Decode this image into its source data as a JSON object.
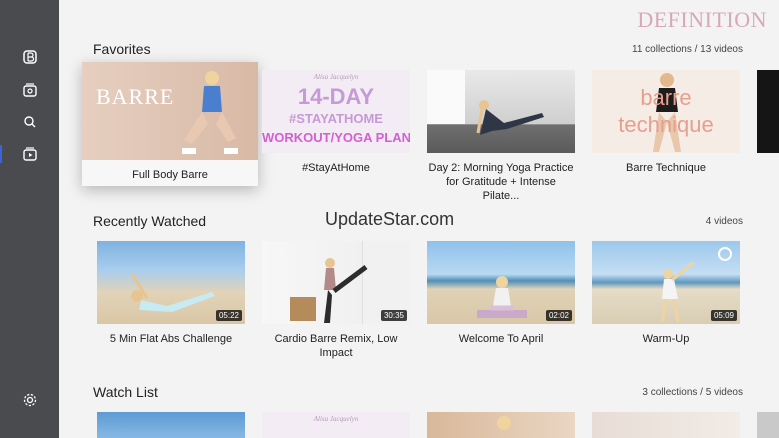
{
  "brand": {
    "name": "DEFINITION"
  },
  "sidebar": {
    "items": [
      {
        "icon": "logo-icon"
      },
      {
        "icon": "library-icon"
      },
      {
        "icon": "search-icon"
      },
      {
        "icon": "playlist-icon"
      },
      {
        "icon": "settings-icon"
      }
    ]
  },
  "sections": {
    "favorites": {
      "title": "Favorites",
      "count": "11 collections / 13 videos",
      "cards": [
        {
          "title": "Full Body Barre",
          "overlay": "BARRE"
        },
        {
          "title": "#StayAtHome",
          "overlay_top": "Alisa Jacquelyn",
          "overlay_main": "14-DAY",
          "overlay_tag": "#STAYATHOME",
          "overlay_sub": "WORKOUT/YOGA PLAN"
        },
        {
          "title": "Day 2: Morning Yoga Practice for Gratitude + Intense Pilate..."
        },
        {
          "title": "Barre Technique",
          "overlay_main": "barre",
          "overlay_sub": "technique"
        }
      ]
    },
    "recent": {
      "title": "Recently Watched",
      "count": "4 videos",
      "cards": [
        {
          "title": "5 Min Flat Abs Challenge",
          "duration": "05:22"
        },
        {
          "title": "Cardio Barre Remix, Low Impact",
          "duration": "30:35"
        },
        {
          "title": "Welcome To April",
          "duration": "02:02"
        },
        {
          "title": "Warm-Up",
          "duration": "05:09"
        }
      ]
    },
    "watchlist": {
      "title": "Watch List",
      "count": "3 collections / 5 videos",
      "cards": [
        {
          "title": ""
        },
        {
          "title": "",
          "overlay_top": "Alisa Jacquelyn"
        },
        {
          "title": ""
        },
        {
          "title": ""
        }
      ]
    }
  },
  "watermark": {
    "text": "UpdateStar.com"
  }
}
